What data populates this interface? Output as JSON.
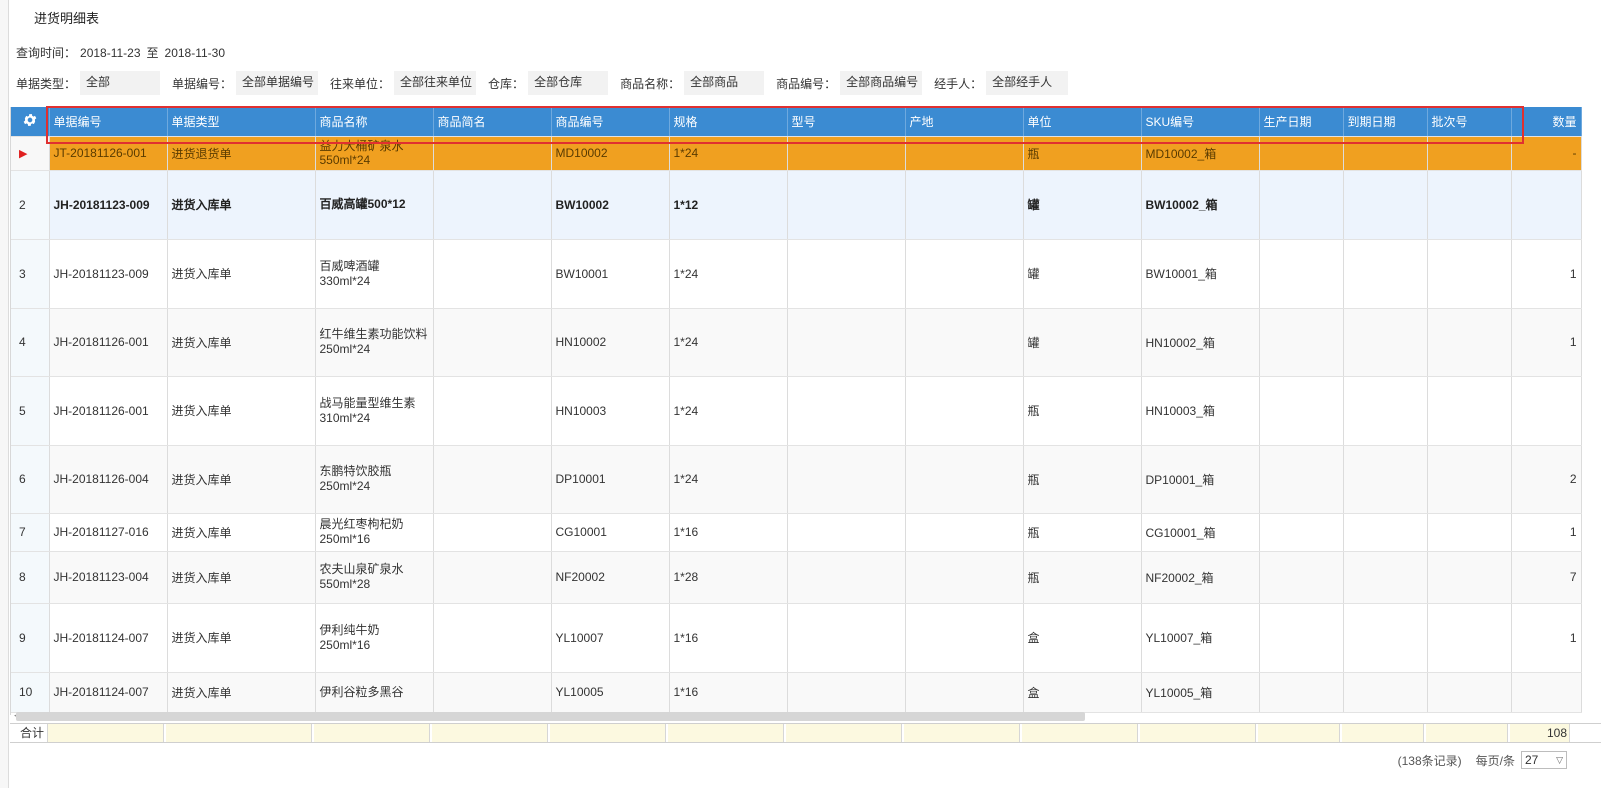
{
  "page": {
    "title": "进货明细表"
  },
  "query": {
    "label": "查询时间：",
    "from": "2018-11-23",
    "sep": "至",
    "to": "2018-11-30"
  },
  "filters": [
    {
      "label": "单据类型：",
      "value": "全部"
    },
    {
      "label": "单据编号：",
      "value": "全部单据编号"
    },
    {
      "label": "往来单位：",
      "value": "全部往来单位"
    },
    {
      "label": "仓库：",
      "value": "全部仓库"
    },
    {
      "label": "商品名称：",
      "value": "全部商品"
    },
    {
      "label": "商品编号：",
      "value": "全部商品编号"
    },
    {
      "label": "经手人：",
      "value": "全部经手人"
    }
  ],
  "table": {
    "settings_icon": "gear-icon",
    "columns": [
      "单据编号",
      "单据类型",
      "商品名称",
      "商品简名",
      "商品编号",
      "规格",
      "型号",
      "产地",
      "单位",
      "SKU编号",
      "生产日期",
      "到期日期",
      "批次号",
      "数量"
    ],
    "rows": [
      {
        "rn": "▶",
        "doc_no": "JT-20181126-001",
        "doc_type": "进货退货单",
        "name": "益力大桶矿泉水",
        "name2": "550ml*24",
        "code": "MD10002",
        "spec": "1*24",
        "unit": "瓶",
        "sku": "MD10002_箱",
        "qty": "-"
      },
      {
        "rn": "2",
        "doc_no": "JH-20181123-009",
        "doc_type": "进货入库单",
        "name": "百威高罐500*12",
        "name2": "",
        "code": "BW10002",
        "spec": "1*12",
        "unit": "罐",
        "sku": "BW10002_箱",
        "qty": ""
      },
      {
        "rn": "3",
        "doc_no": "JH-20181123-009",
        "doc_type": "进货入库单",
        "name": "百威啤酒罐",
        "name2": "330ml*24",
        "code": "BW10001",
        "spec": "1*24",
        "unit": "罐",
        "sku": "BW10001_箱",
        "qty": "1"
      },
      {
        "rn": "4",
        "doc_no": "JH-20181126-001",
        "doc_type": "进货入库单",
        "name": "红牛维生素功能饮料",
        "name2": "250ml*24",
        "code": "HN10002",
        "spec": "1*24",
        "unit": "罐",
        "sku": "HN10002_箱",
        "qty": "1"
      },
      {
        "rn": "5",
        "doc_no": "JH-20181126-001",
        "doc_type": "进货入库单",
        "name": "战马能量型维生素",
        "name2": "310ml*24",
        "code": "HN10003",
        "spec": "1*24",
        "unit": "瓶",
        "sku": "HN10003_箱",
        "qty": ""
      },
      {
        "rn": "6",
        "doc_no": "JH-20181126-004",
        "doc_type": "进货入库单",
        "name": "东鹏特饮胶瓶",
        "name2": "250ml*24",
        "code": "DP10001",
        "spec": "1*24",
        "unit": "瓶",
        "sku": "DP10001_箱",
        "qty": "2"
      },
      {
        "rn": "7",
        "doc_no": "JH-20181127-016",
        "doc_type": "进货入库单",
        "name": "晨光红枣枸杞奶",
        "name2": "250ml*16",
        "code": "CG10001",
        "spec": "1*16",
        "unit": "瓶",
        "sku": "CG10001_箱",
        "qty": "1"
      },
      {
        "rn": "8",
        "doc_no": "JH-20181123-004",
        "doc_type": "进货入库单",
        "name": "农夫山泉矿泉水",
        "name2": "550ml*28",
        "code": "NF20002",
        "spec": "1*28",
        "unit": "瓶",
        "sku": "NF20002_箱",
        "qty": "7"
      },
      {
        "rn": "9",
        "doc_no": "JH-20181124-007",
        "doc_type": "进货入库单",
        "name": "伊利纯牛奶",
        "name2": "250ml*16",
        "code": "YL10007",
        "spec": "1*16",
        "unit": "盒",
        "sku": "YL10007_箱",
        "qty": "1"
      },
      {
        "rn": "10",
        "doc_no": "JH-20181124-007",
        "doc_type": "进货入库单",
        "name": "伊利谷粒多黑谷",
        "name2": "",
        "code": "YL10005",
        "spec": "1*16",
        "unit": "盒",
        "sku": "YL10005_箱",
        "qty": ""
      }
    ]
  },
  "totals": {
    "label": "合计",
    "qty": "108"
  },
  "pager": {
    "count": "(138条记录)",
    "per_page_label": "每页/条",
    "per_page_value": "27"
  },
  "colors": {
    "header": "#3b8bd2",
    "selected_row": "#f0a020",
    "highlight_box": "#e03030"
  }
}
